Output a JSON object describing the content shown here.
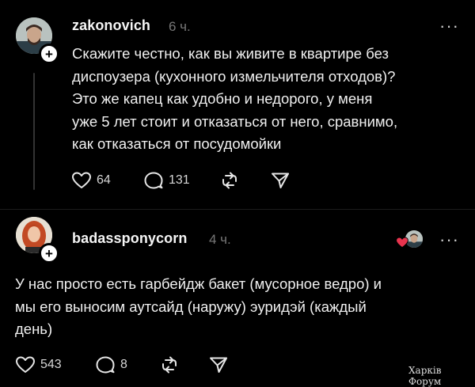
{
  "post": {
    "username": "zakonovich",
    "time": "6 ч.",
    "text_lines": [
      "Скажите честно, как вы живите в квартире без",
      "диспоузера (кухонного измельчителя отходов)?",
      "Это же капец как удобно и недорого, у меня",
      "уже 5 лет стоит и отказаться от него, сравнимо,",
      "как отказаться от посудомойки"
    ],
    "likes": "64",
    "replies": "131",
    "more_label": "···",
    "plus_label": "+"
  },
  "reply": {
    "username": "badassponycorn",
    "time": "4 ч.",
    "text_lines": [
      "У нас просто есть гарбейдж бакет (мусорное ведро) и",
      "мы его выносим аутсайд (наружу) эуридэй (каждый",
      "день)"
    ],
    "likes": "543",
    "replies": "8",
    "more_label": "···",
    "plus_label": "+"
  },
  "watermark": "Харків Форум",
  "colors": {
    "background": "#000000",
    "text": "#f0f0f0",
    "muted": "#777777",
    "like_heart": "#e8344e"
  },
  "icons": [
    "heart-icon",
    "comment-icon",
    "repost-icon",
    "share-icon",
    "more-icon",
    "follow-plus-icon"
  ]
}
